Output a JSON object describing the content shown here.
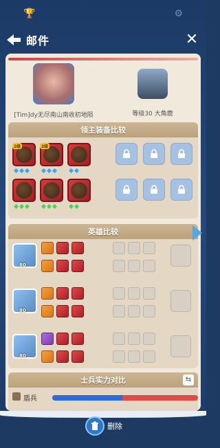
{
  "window": {
    "title": "邮件"
  },
  "players": {
    "left": {
      "name": "[Tim]dy无尽南山南收初地陨"
    },
    "right": {
      "name": "等级30 大角鹿"
    }
  },
  "sections": {
    "lord_equipment": "领主装备比较",
    "hero_comparison": "英雄比较",
    "soldier_comparison": "士兵实力对比"
  },
  "lord_equipment": {
    "items": [
      {
        "level": "2级",
        "gems": 3
      },
      {
        "level": "2级",
        "gems": 3
      },
      {
        "level": "",
        "gems": 2
      },
      {
        "level": "",
        "gems": 3
      },
      {
        "level": "",
        "gems": 3
      },
      {
        "level": "",
        "gems": 2
      }
    ]
  },
  "heroes": [
    {
      "level": "80"
    },
    {
      "level": "80"
    },
    {
      "level": "80"
    }
  ],
  "soldiers": {
    "row_label": "盾兵",
    "power_ratio": 0.48
  },
  "bottom": {
    "delete_label": "删除"
  },
  "colors": {
    "accent": "#2e78c8",
    "panel": "#f1e9dc",
    "header_bg": "#1d3a63"
  }
}
